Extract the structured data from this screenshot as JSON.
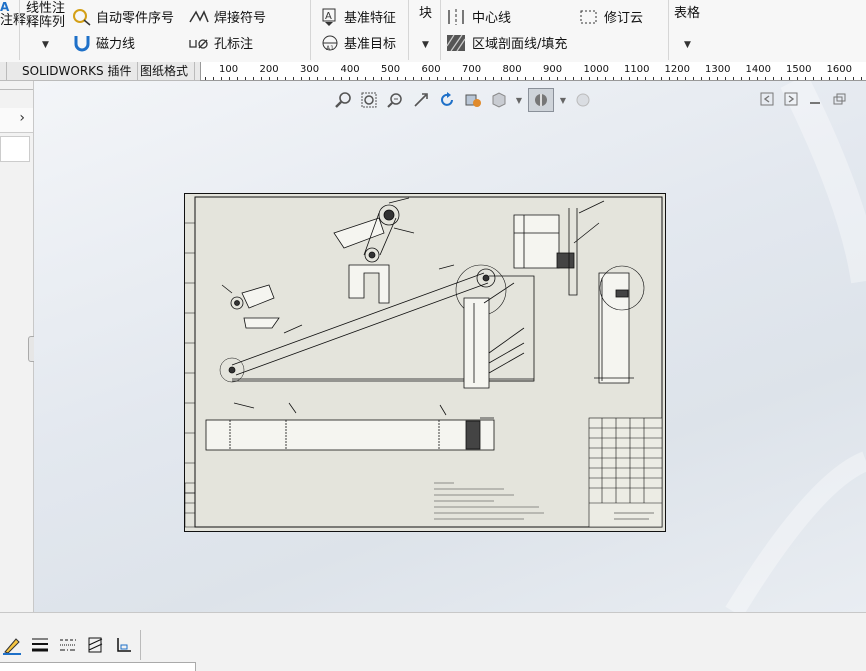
{
  "ribbon": {
    "partial_left_label": "注释",
    "linear_note_pattern": [
      "线性注",
      "释阵列"
    ],
    "auto_balloon": "自动零件序号",
    "magnetic_line": "磁力线",
    "weld_symbol": "焊接符号",
    "hole_callout": "孔标注",
    "datum_feature": "基准特征",
    "datum_target": "基准目标",
    "block": "块",
    "centerline": "中心线",
    "area_hatch": "区域剖面线/填充",
    "revision_cloud": "修订云",
    "tables": "表格"
  },
  "tabs": [
    {
      "label": "SOLIDWORKS 插件"
    },
    {
      "label": "图纸格式"
    }
  ],
  "ruler": {
    "ticks": [
      "100",
      "200",
      "300",
      "400",
      "500",
      "600",
      "700",
      "800",
      "900",
      "1000",
      "1100",
      "1200",
      "1300",
      "1400",
      "1500",
      "1600"
    ]
  },
  "colors": {
    "sheet": "#e4e4dc",
    "accent": "#1e70c8",
    "line": "#222222"
  }
}
